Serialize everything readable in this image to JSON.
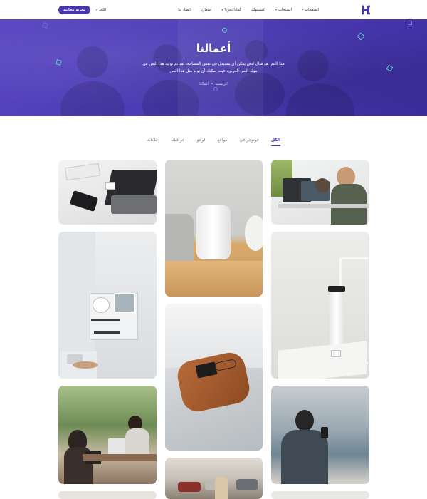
{
  "header": {
    "trial_button": "تجربة مجانية",
    "language": "اللغة",
    "nav": [
      {
        "label": "الصفحات",
        "has_menu": true
      },
      {
        "label": "المنتجات",
        "has_menu": true
      },
      {
        "label": "المستهلك",
        "has_menu": false
      },
      {
        "label": "لماذا نحن؟",
        "has_menu": true
      },
      {
        "label": "أسعارنا",
        "has_menu": false
      },
      {
        "label": "إتصل بنا",
        "has_menu": false
      }
    ],
    "chevron": "▾"
  },
  "hero": {
    "title": "أعمالنا",
    "text": "هذا النص هو مثال لنص يمكن أن يستبدل في نفس المساحة، لقد تم توليد هذا النص من مولد النص العربى، حيث يمكنك أن تولد مثل هذا النص",
    "breadcrumb": {
      "home": "الرئيسية",
      "separator": "•",
      "current": "أعمالنا"
    }
  },
  "tabs": [
    "الكل",
    "فوتوجرافي",
    "مواقع",
    "لوجو",
    "جرافيك",
    "إعلانات"
  ],
  "colors": {
    "brand": "#4a35a8",
    "accent": "#55d6c2"
  }
}
